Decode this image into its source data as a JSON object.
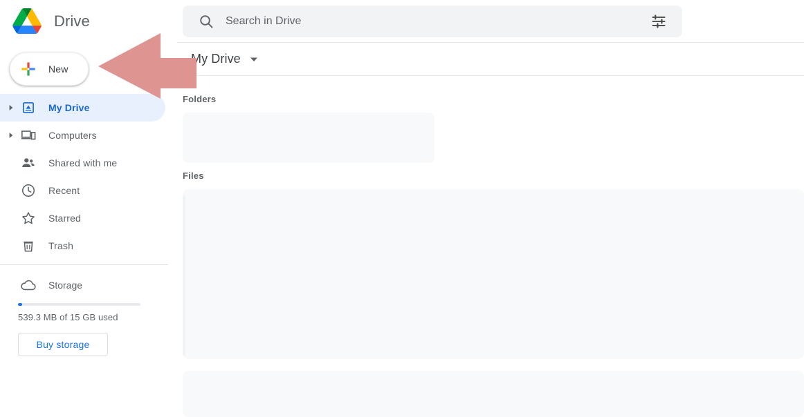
{
  "sidebar": {
    "brand": {
      "title": "Drive",
      "logo_icon": "google-drive-logo"
    },
    "new_button": {
      "label": "New",
      "icon": "plus-icon"
    },
    "nav_items": [
      {
        "label": "My Drive",
        "icon": "my-drive-icon",
        "expandable": true,
        "selected": true
      },
      {
        "label": "Computers",
        "icon": "computers-icon",
        "expandable": true,
        "selected": false
      },
      {
        "label": "Shared with me",
        "icon": "people-icon",
        "expandable": false,
        "selected": false
      },
      {
        "label": "Recent",
        "icon": "clock-icon",
        "expandable": false,
        "selected": false
      },
      {
        "label": "Starred",
        "icon": "star-icon",
        "expandable": false,
        "selected": false
      },
      {
        "label": "Trash",
        "icon": "trash-icon",
        "expandable": false,
        "selected": false
      }
    ],
    "storage": {
      "label": "Storage",
      "icon": "cloud-icon",
      "used_text": "539.3 MB of 15 GB used",
      "percent_used": 3.5,
      "buy_button_label": "Buy storage"
    }
  },
  "search": {
    "placeholder": "Search in Drive",
    "value": "",
    "search_icon": "search-icon",
    "filter_icon": "tune-icon"
  },
  "content": {
    "breadcrumb": {
      "label": "My Drive",
      "caret_icon": "chevron-down-icon"
    },
    "sections": {
      "folders_label": "Folders",
      "files_label": "Files"
    }
  },
  "overlay": {
    "arrow": {
      "name": "pointer-arrow",
      "direction": "left",
      "color": "#de9491"
    }
  },
  "colors": {
    "accent_blue": "#1a73e8",
    "selected_blue": "#1967d2",
    "selected_bg": "#e8f0fe",
    "text_gray": "#5f6368",
    "surface_gray": "#f1f3f4",
    "placeholder_gray": "#f8f9fa"
  }
}
